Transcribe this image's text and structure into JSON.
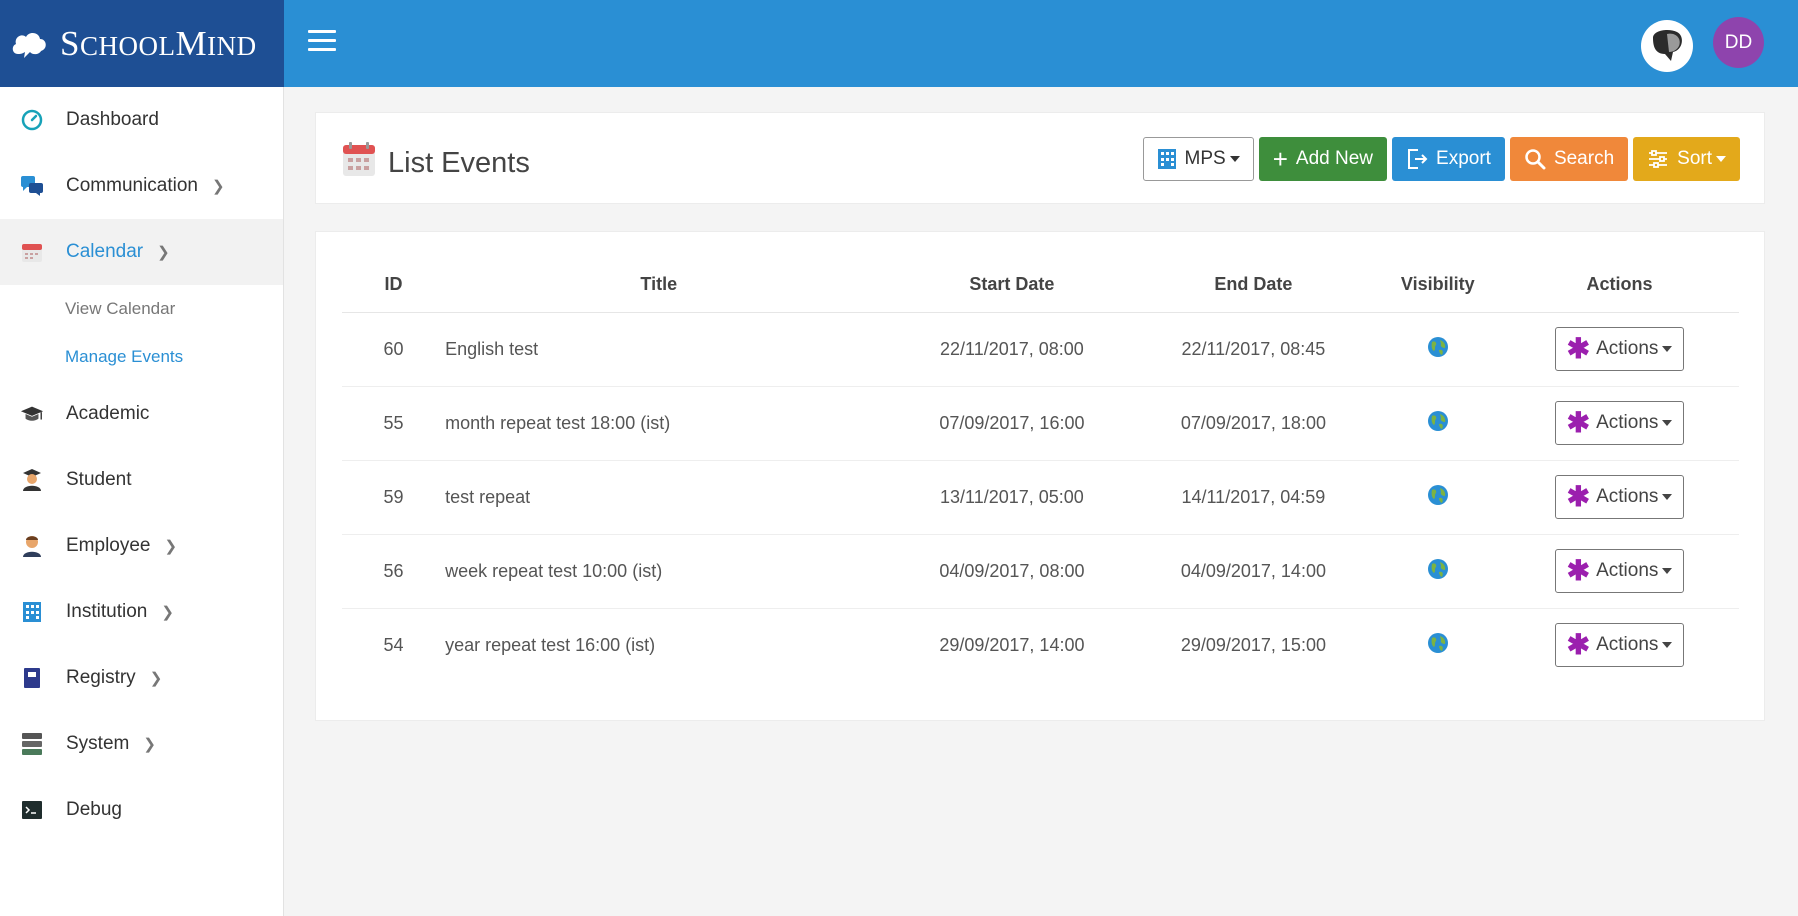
{
  "brand": {
    "big1": "S",
    "small1": "CHOOL",
    "big2": "M",
    "small2": "IND"
  },
  "user": {
    "initials": "DD"
  },
  "sidebar": {
    "items": [
      {
        "label": "Dashboard",
        "icon": "dashboard-icon"
      },
      {
        "label": "Communication",
        "icon": "chat-icon"
      },
      {
        "label": "Calendar",
        "icon": "calendar-icon"
      },
      {
        "label": "Academic",
        "icon": "graduation-cap-icon"
      },
      {
        "label": "Student",
        "icon": "student-icon"
      },
      {
        "label": "Employee",
        "icon": "employee-icon"
      },
      {
        "label": "Institution",
        "icon": "building-icon"
      },
      {
        "label": "Registry",
        "icon": "book-icon"
      },
      {
        "label": "System",
        "icon": "server-icon"
      },
      {
        "label": "Debug",
        "icon": "terminal-icon"
      }
    ],
    "calendar_sub": [
      {
        "label": "View Calendar"
      },
      {
        "label": "Manage Events"
      }
    ]
  },
  "header": {
    "title": "List Events",
    "mps_label": "MPS",
    "add_label": "Add New",
    "export_label": "Export",
    "search_label": "Search",
    "sort_label": "Sort"
  },
  "table": {
    "columns": [
      "ID",
      "Title",
      "Start Date",
      "End Date",
      "Visibility",
      "Actions"
    ],
    "action_label": "Actions",
    "rows": [
      {
        "id": "60",
        "title": "English test",
        "start": "22/11/2017, 08:00",
        "end": "22/11/2017, 08:45"
      },
      {
        "id": "55",
        "title": "month repeat test 18:00 (ist)",
        "start": "07/09/2017, 16:00",
        "end": "07/09/2017, 18:00"
      },
      {
        "id": "59",
        "title": "test repeat",
        "start": "13/11/2017, 05:00",
        "end": "14/11/2017, 04:59"
      },
      {
        "id": "56",
        "title": "week repeat test 10:00 (ist)",
        "start": "04/09/2017, 08:00",
        "end": "04/09/2017, 14:00"
      },
      {
        "id": "54",
        "title": "year repeat test 16:00 (ist)",
        "start": "29/09/2017, 14:00",
        "end": "29/09/2017, 15:00"
      }
    ]
  },
  "colors": {
    "brand": "#1e4f94",
    "topbar": "#2a8fd4",
    "add": "#3e8e3c",
    "export": "#2a8fd4",
    "search": "#f0883a",
    "sort": "#e3a91b",
    "avatar": "#8e44ad"
  }
}
